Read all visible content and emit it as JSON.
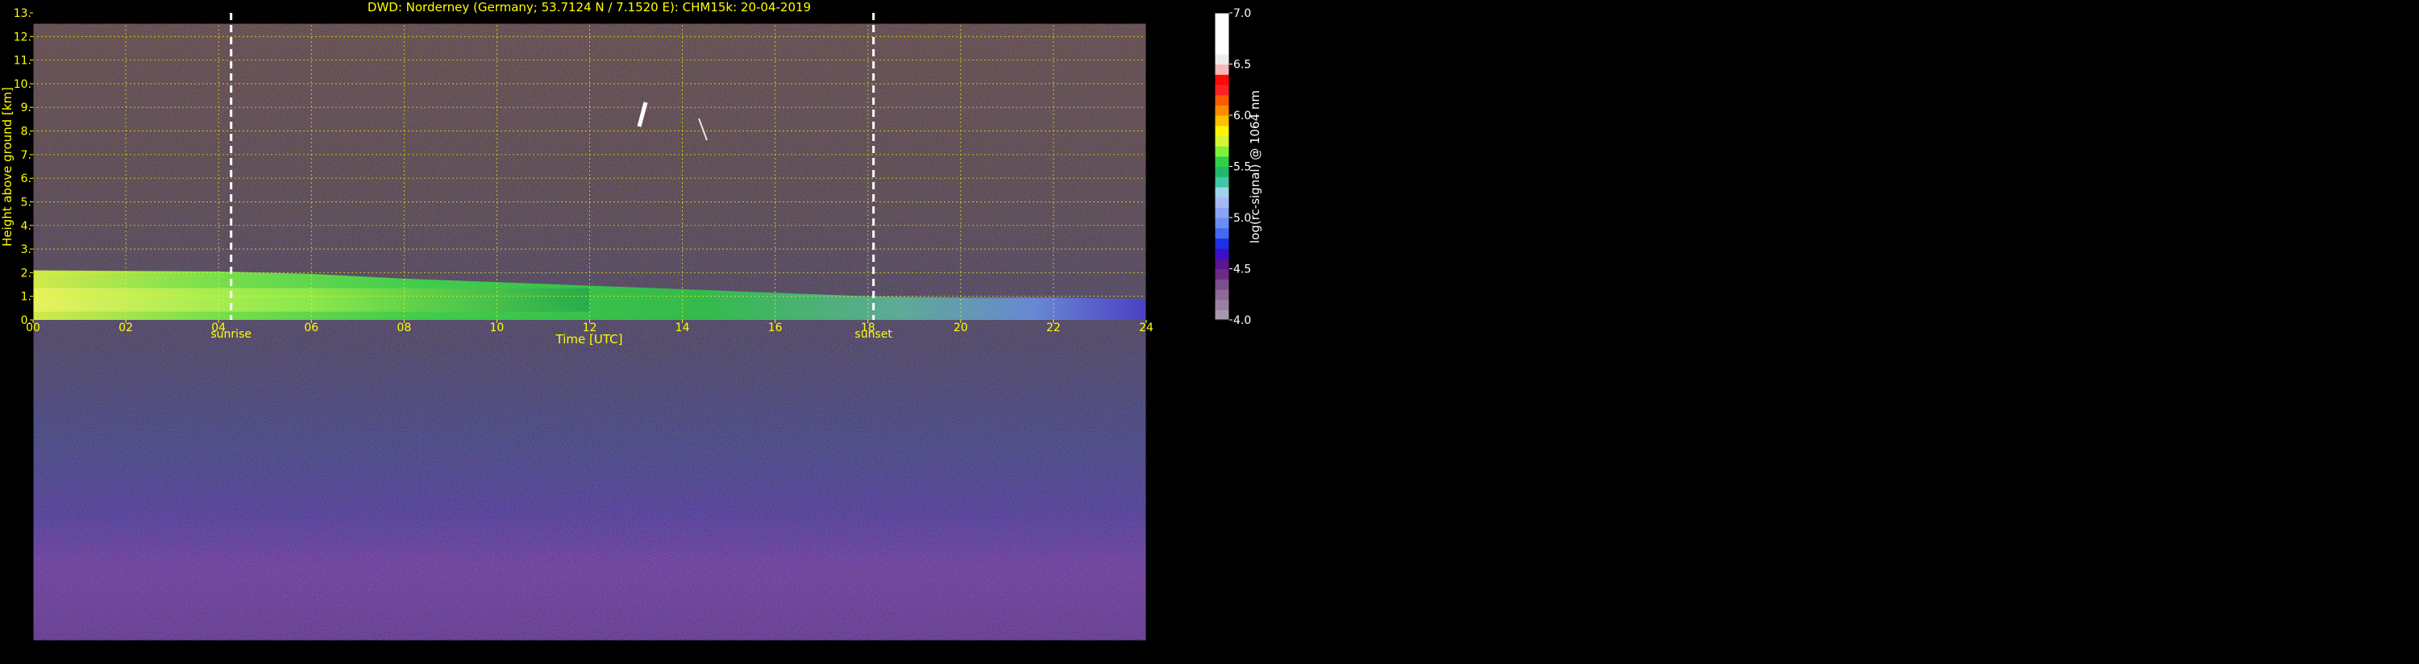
{
  "chart_data": {
    "type": "heatmap",
    "title": "DWD: Norderney (Germany; 53.7124 N / 7.1520 E):    CHM15k: 20-04-2019",
    "xlabel": "Time [UTC]",
    "ylabel": "Height above ground [km]",
    "xlim": [
      0,
      24
    ],
    "ylim": [
      0,
      13
    ],
    "x_ticks": [
      "00",
      "02",
      "04",
      "06",
      "08",
      "10",
      "12",
      "14",
      "16",
      "18",
      "20",
      "22",
      "24"
    ],
    "y_ticks": [
      "0.",
      "1.",
      "2.",
      "3.",
      "4.",
      "5.",
      "6.",
      "7.",
      "8.",
      "9.",
      "10.",
      "11.",
      "12.",
      "13."
    ],
    "grid": true,
    "markers": [
      {
        "label": "sunrise",
        "x": 4.27
      },
      {
        "label": "sunset",
        "x": 18.12
      }
    ],
    "boundary_layer_top_km": {
      "x": [
        0,
        4,
        6,
        8,
        10,
        12,
        14,
        16,
        18,
        20,
        22,
        23.5,
        24
      ],
      "y": [
        2.1,
        2.05,
        1.95,
        1.75,
        1.6,
        1.45,
        1.3,
        1.15,
        1.0,
        0.95,
        0.95,
        0.9,
        0.9
      ]
    },
    "colorbar": {
      "label": "log(rc-signal) @ 1064 nm",
      "range": [
        4.0,
        7.0
      ],
      "ticks": [
        "4.0",
        "4.5",
        "5.0",
        "5.5",
        "6.0",
        "6.5",
        "7.0"
      ],
      "colors": [
        "#a898ab",
        "#9b80a0",
        "#8d6a98",
        "#7a4f8e",
        "#6a2a86",
        "#5a1590",
        "#3a10c8",
        "#2030e8",
        "#4468f0",
        "#6a8cf4",
        "#8aa4f4",
        "#a6b9f5",
        "#9fd2ec",
        "#40c7a6",
        "#22b86b",
        "#2fd04a",
        "#7ef03a",
        "#d6f633",
        "#fff20a",
        "#ffc000",
        "#ff8c00",
        "#ff5a00",
        "#ff2222",
        "#ff0a0a",
        "#f7b8b8",
        "#ececec",
        "#ffffff",
        "#ffffff",
        "#ffffff",
        "#ffffff"
      ]
    }
  }
}
